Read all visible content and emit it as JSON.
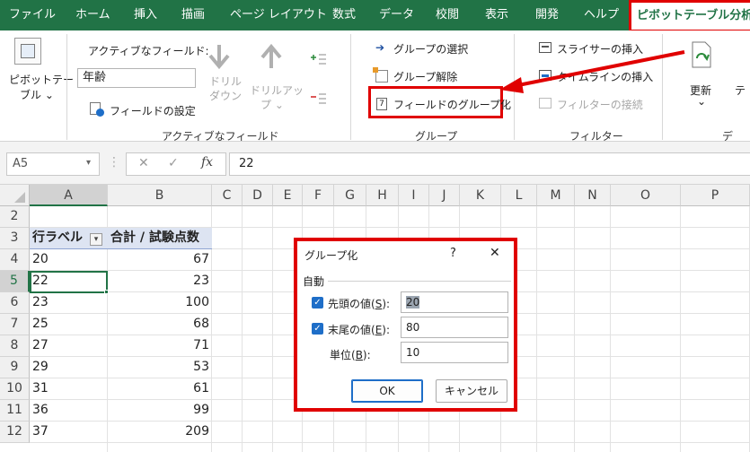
{
  "menu": {
    "tabs": [
      "ファイル",
      "ホーム",
      "挿入",
      "描画",
      "ページ レイアウト",
      "数式",
      "データ",
      "校閲",
      "表示",
      "開発",
      "ヘルプ"
    ],
    "active_tab": "ピボットテーブル分析"
  },
  "ribbon": {
    "pivot_button": {
      "line1": "ピボットテー",
      "line2": "ブル ⌄"
    },
    "active_field": {
      "label": "アクティブなフィールド:",
      "value": "年齢",
      "settings": "フィールドの設定",
      "drill_down": {
        "line1": "ドリル",
        "line2": "ダウン"
      },
      "drill_up": {
        "line1": "ドリルアッ",
        "line2": "プ ⌄"
      },
      "group_label": "アクティブなフィールド"
    },
    "group": {
      "select": "グループの選択",
      "ungroup": "グループ解除",
      "field_group": "フィールドのグループ化",
      "group_label": "グループ"
    },
    "filter": {
      "slicer": "スライサーの挿入",
      "timeline": "タイムラインの挿入",
      "connections": "フィルターの接続",
      "group_label": "フィルター"
    },
    "data": {
      "refresh": "更新",
      "refresh_arrow": "⌄",
      "group_label": "デ"
    }
  },
  "formula_bar": {
    "name_box": "A5",
    "dropdown": "▾",
    "cancel": "✕",
    "enter": "✓",
    "fx": "fx",
    "value": "22"
  },
  "sheet": {
    "columns": [
      "A",
      "B",
      "C",
      "D",
      "E",
      "F",
      "G",
      "H",
      "I",
      "J",
      "K",
      "L",
      "M",
      "N",
      "O",
      "P"
    ],
    "rows": [
      {
        "num": "2",
        "a": "",
        "b": ""
      },
      {
        "num": "3",
        "a": "行ラベル",
        "b": "合計 / 試験点数"
      },
      {
        "num": "4",
        "a": "20",
        "b": "67"
      },
      {
        "num": "5",
        "a": "22",
        "b": "23"
      },
      {
        "num": "6",
        "a": "23",
        "b": "100"
      },
      {
        "num": "7",
        "a": "25",
        "b": "68"
      },
      {
        "num": "8",
        "a": "27",
        "b": "71"
      },
      {
        "num": "9",
        "a": "29",
        "b": "53"
      },
      {
        "num": "10",
        "a": "31",
        "b": "61"
      },
      {
        "num": "11",
        "a": "36",
        "b": "99"
      },
      {
        "num": "12",
        "a": "37",
        "b": "209"
      }
    ],
    "filter_arrow": "▾"
  },
  "dialog": {
    "title": "グループ化",
    "help": "?",
    "close": "✕",
    "section": "自動",
    "start": {
      "label": "先頭の値(",
      "key": "S",
      "tail": "):",
      "value": "20",
      "checked": "✓"
    },
    "end": {
      "label": "末尾の値(",
      "key": "E",
      "tail": "):",
      "value": "80",
      "checked": "✓"
    },
    "step": {
      "label": "単位(",
      "key": "B",
      "tail": "):",
      "value": "10"
    },
    "ok": "OK",
    "cancel": "キャンセル"
  },
  "colors": {
    "excel_green": "#217346",
    "highlight_red": "#e00000",
    "checkbox_blue": "#1e6ec8"
  }
}
